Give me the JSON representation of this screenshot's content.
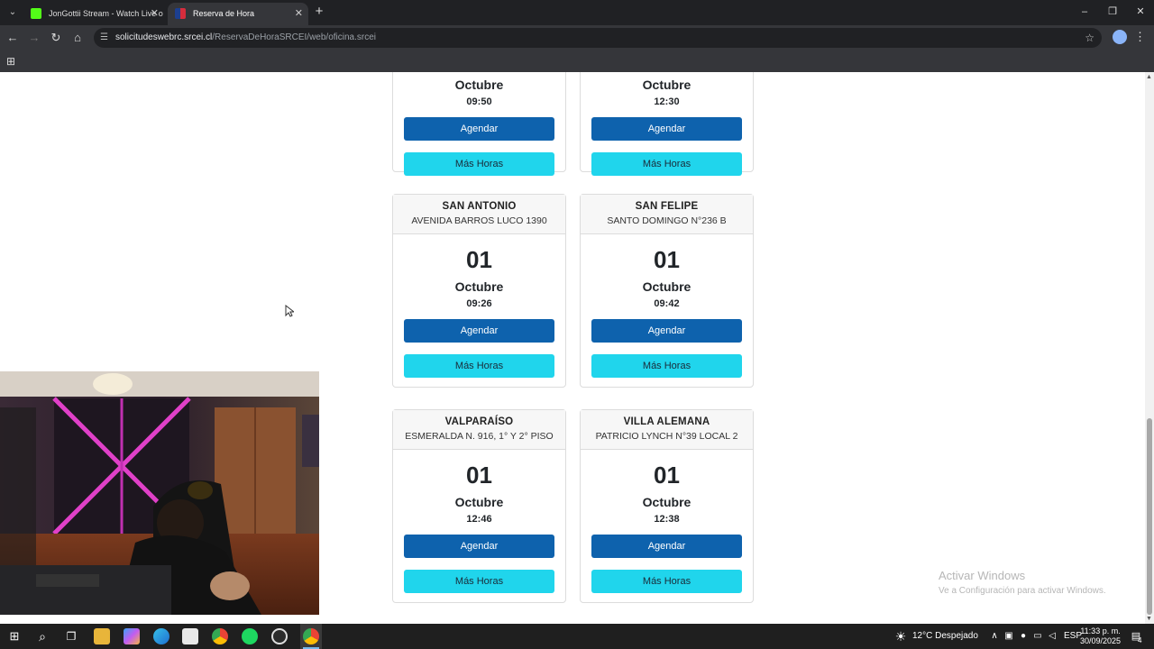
{
  "browser": {
    "tabs": [
      {
        "title": "JonGottii Stream - Watch Live o",
        "favicon_color": "#53fc18"
      },
      {
        "title": "Reserva de Hora",
        "favicon_color": "#d62d3c"
      }
    ],
    "url_host": "solicitudeswebrc.srcei.cl",
    "url_path": "/ReservaDeHoraSRCEI/web/oficina.srcei"
  },
  "offices": [
    {
      "name": "",
      "address": "",
      "day": "",
      "month": "Octubre",
      "time": "09:50",
      "agendar_label": "Agendar",
      "mas_label": "Más Horas"
    },
    {
      "name": "",
      "address": "",
      "day": "",
      "month": "Octubre",
      "time": "12:30",
      "agendar_label": "Agendar",
      "mas_label": "Más Horas"
    },
    {
      "name": "SAN ANTONIO",
      "address": "AVENIDA BARROS LUCO 1390",
      "day": "01",
      "month": "Octubre",
      "time": "09:26",
      "agendar_label": "Agendar",
      "mas_label": "Más Horas"
    },
    {
      "name": "SAN FELIPE",
      "address": "SANTO DOMINGO N°236 B",
      "day": "01",
      "month": "Octubre",
      "time": "09:42",
      "agendar_label": "Agendar",
      "mas_label": "Más Horas"
    },
    {
      "name": "VALPARAÍSO",
      "address": "ESMERALDA N. 916, 1° Y 2° PISO",
      "day": "01",
      "month": "Octubre",
      "time": "12:46",
      "agendar_label": "Agendar",
      "mas_label": "Más Horas"
    },
    {
      "name": "VILLA ALEMANA",
      "address": "PATRICIO LYNCH N°39 LOCAL 2",
      "day": "01",
      "month": "Octubre",
      "time": "12:38",
      "agendar_label": "Agendar",
      "mas_label": "Más Horas"
    }
  ],
  "watermark": {
    "line1": "Activar Windows",
    "line2": "Ve a Configuración para activar Windows."
  },
  "taskbar": {
    "weather": "12°C  Despejado",
    "language": "ESP",
    "time": "11:33 p. m.",
    "date": "30/09/2025",
    "notifications": "4"
  },
  "colors": {
    "agendar": "#0e62ad",
    "mas_horas": "#20d5ec"
  }
}
